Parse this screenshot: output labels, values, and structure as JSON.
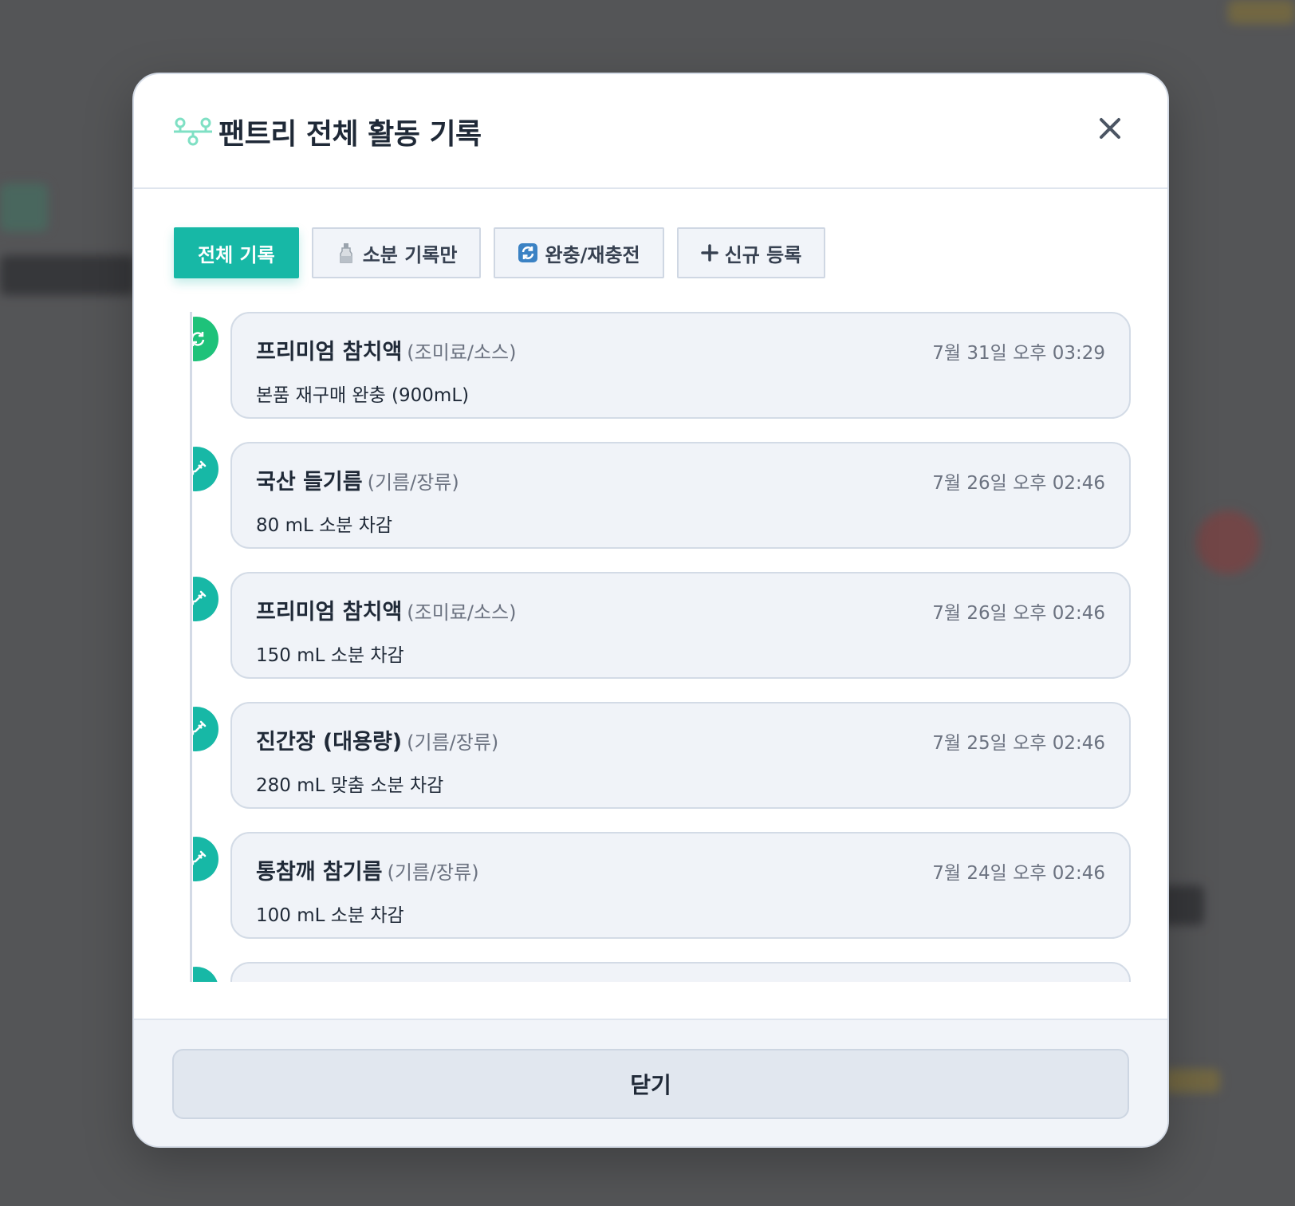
{
  "modal": {
    "title": "팬트리 전체 활동 기록",
    "close_footer_label": "닫기"
  },
  "tabs": [
    {
      "label": "전체 기록",
      "icon": "list",
      "active": true
    },
    {
      "label": "소분 기록만",
      "icon": "bottle-icon",
      "active": false
    },
    {
      "label": "완충/재충전",
      "icon": "refresh-icon",
      "active": false
    },
    {
      "label": "신규 등록",
      "icon": "plus-icon",
      "active": false
    }
  ],
  "entries": [
    {
      "name": "프리미엄 참치액",
      "category": "(조미료/소스)",
      "time": "7월 31일 오후 03:29",
      "desc": "본품 재구매 완충 (900mL)",
      "type": "refill"
    },
    {
      "name": "국산 들기름",
      "category": "(기름/장류)",
      "time": "7월 26일 오후 02:46",
      "desc": "80 mL 소분 차감",
      "type": "portion"
    },
    {
      "name": "프리미엄 참치액",
      "category": "(조미료/소스)",
      "time": "7월 26일 오후 02:46",
      "desc": "150 mL 소분 차감",
      "type": "portion"
    },
    {
      "name": "진간장 (대용량)",
      "category": "(기름/장류)",
      "time": "7월 25일 오후 02:46",
      "desc": "280 mL 맞춤 소분 차감",
      "type": "portion"
    },
    {
      "name": "통참깨 참기름",
      "category": "(기름/장류)",
      "time": "7월 24일 오후 02:46",
      "desc": "100 mL 소분 차감",
      "type": "portion"
    }
  ],
  "colors": {
    "accent": "#17b8a6",
    "refill": "#1ec27a",
    "portion": "#17b8a6"
  }
}
